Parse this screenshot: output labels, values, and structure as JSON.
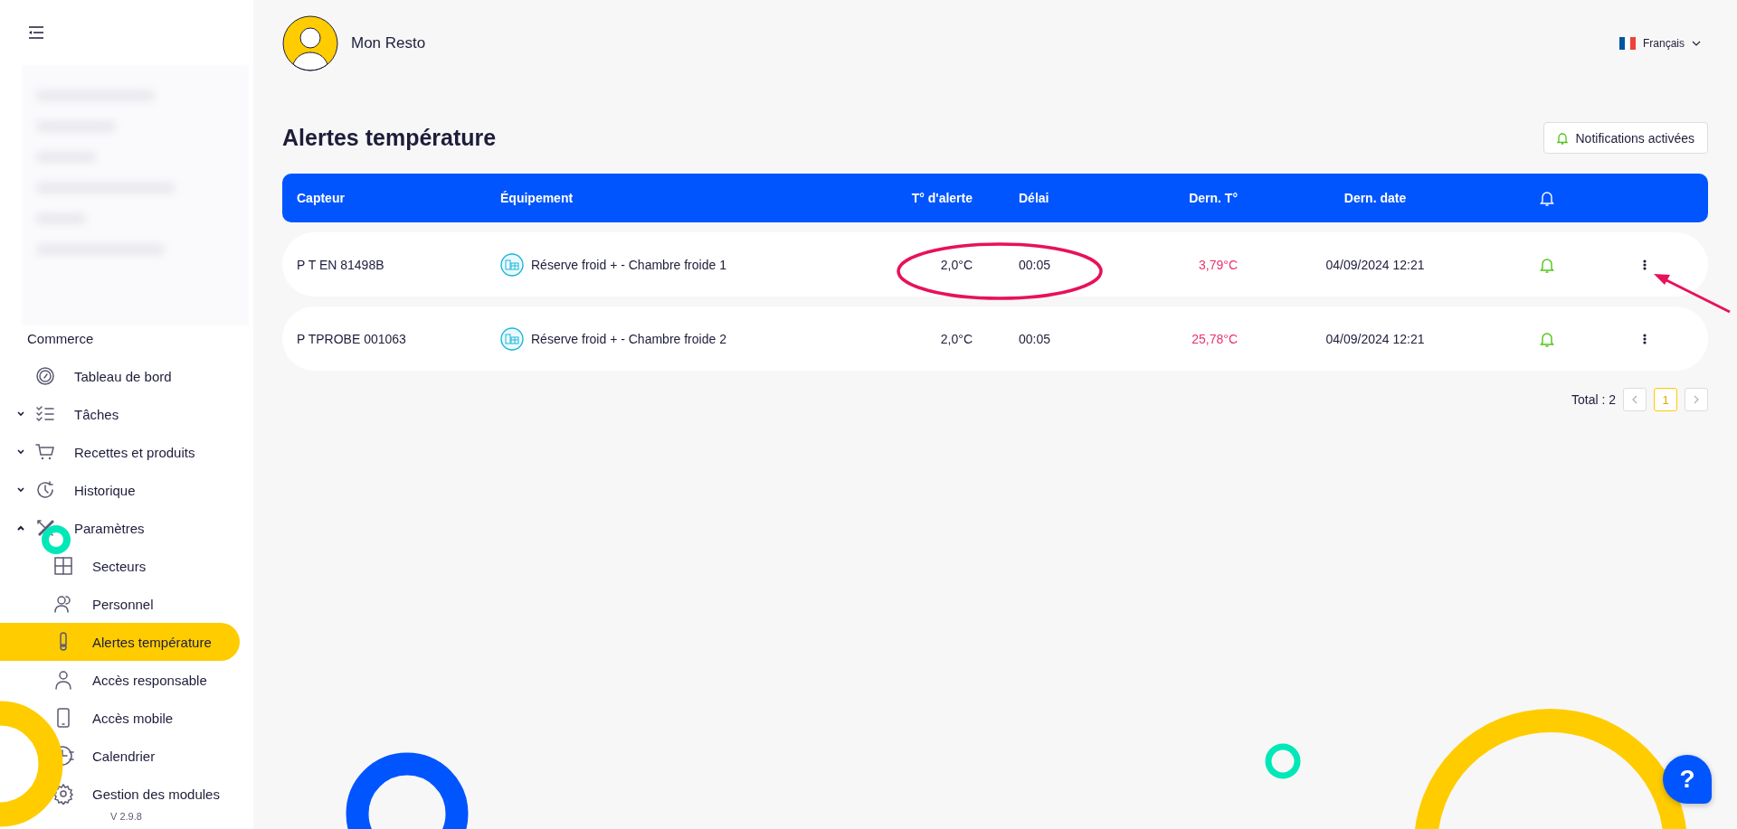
{
  "sidebar": {
    "section": "Commerce",
    "items": [
      {
        "label": "Tableau de bord",
        "selected": false
      },
      {
        "label": "Tâches",
        "selected": false,
        "expanded": false
      },
      {
        "label": "Recettes et produits",
        "selected": false,
        "expanded": false
      },
      {
        "label": "Historique",
        "selected": false,
        "expanded": false
      },
      {
        "label": "Paramètres",
        "selected": false,
        "expanded": true,
        "children": [
          {
            "label": "Secteurs",
            "selected": false
          },
          {
            "label": "Personnel",
            "selected": false
          },
          {
            "label": "Alertes température",
            "selected": true
          },
          {
            "label": "Accès responsable",
            "selected": false
          },
          {
            "label": "Accès mobile",
            "selected": false
          },
          {
            "label": "Calendrier",
            "selected": false
          },
          {
            "label": "Gestion des modules",
            "selected": false
          }
        ]
      }
    ],
    "version": "V 2.9.8"
  },
  "header": {
    "restaurant": "Mon Resto",
    "language": "Français"
  },
  "page": {
    "title": "Alertes température",
    "notifications_button": {
      "label": "Notifications activées",
      "on": true
    }
  },
  "table": {
    "columns": [
      "Capteur",
      "Équipement",
      "T° d'alerte",
      "Délai",
      "Dern. T°",
      "Dern. date"
    ],
    "rows": [
      {
        "sensor": "P T EN 81498B",
        "equipment": "Réserve froid + - Chambre froide 1",
        "alert_temp": "2,0°C",
        "delay": "00:05",
        "last_temp": "3,79°C",
        "over_limit": true,
        "last_date": "04/09/2024 12:21",
        "notify": true
      },
      {
        "sensor": "P TPROBE 001063",
        "equipment": "Réserve froid + - Chambre froide 2",
        "alert_temp": "2,0°C",
        "delay": "00:05",
        "last_temp": "25,78°C",
        "over_limit": true,
        "last_date": "04/09/2024 12:21",
        "notify": true
      }
    ]
  },
  "pagination": {
    "total": "Total : 2",
    "pages": [
      {
        "label": "1",
        "selected": true
      }
    ]
  },
  "help_button": {
    "label": "?"
  }
}
